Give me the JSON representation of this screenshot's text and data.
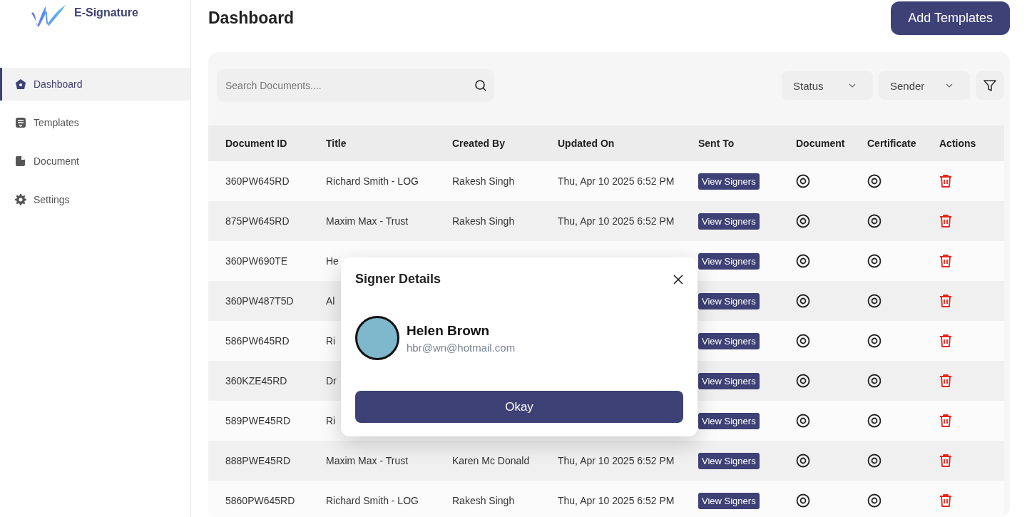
{
  "brand": {
    "name": "E-Signature"
  },
  "sidebar": {
    "items": [
      {
        "label": "Dashboard",
        "kind": "home",
        "selected": true
      },
      {
        "label": "Templates",
        "kind": "templates",
        "selected": false
      },
      {
        "label": "Document",
        "kind": "document",
        "selected": false
      },
      {
        "label": "Settings",
        "kind": "settings",
        "selected": false
      }
    ]
  },
  "header": {
    "title": "Dashboard",
    "add_button": "Add Templates"
  },
  "toolbar": {
    "search": {
      "placeholder": "Search Documents...."
    },
    "filters": [
      "Status",
      "Sender"
    ]
  },
  "table": {
    "columns": [
      "Document ID",
      "Title",
      "Created By",
      "Updated On",
      "Sent To",
      "Document",
      "Certificate",
      "Actions"
    ],
    "rows": [
      {
        "document_id": "360PW645RD",
        "title": "Richard Smith - LOG",
        "created_by": "Rakesh Singh",
        "updated_on": "Thu, Apr 10 2025 6:52 PM",
        "sent_to": "View Signers"
      },
      {
        "document_id": "875PW645RD",
        "title": "Maxim Max - Trust",
        "created_by": "Rakesh Singh",
        "updated_on": "Thu, Apr 10 2025 6:52 PM",
        "sent_to": "View Signers"
      },
      {
        "document_id": "360PW690TE",
        "title": "He",
        "sent_to": "View Signers"
      },
      {
        "document_id": "360PW487T5D",
        "title": "Al",
        "sent_to": "View Signers"
      },
      {
        "document_id": "586PW645RD",
        "title": "Ri",
        "sent_to": "View Signers"
      },
      {
        "document_id": "360KZE45RD",
        "title": "Dr",
        "sent_to": "View Signers"
      },
      {
        "document_id": "589PWE45RD",
        "title": "Ri",
        "sent_to": "View Signers"
      },
      {
        "document_id": "888PWE45RD",
        "title": "Maxim Max - Trust",
        "created_by": "Karen Mc Donald",
        "updated_on": "Thu, Apr 10 2025 6:52 PM",
        "sent_to": "View Signers"
      },
      {
        "document_id": "5860PW645RD",
        "title": "Richard Smith - LOG",
        "created_by": "Rakesh Singh",
        "updated_on": "Thu, Apr 10 2025 6:52 PM",
        "sent_to": "View Signers"
      }
    ]
  },
  "modal": {
    "title": "Signer Details",
    "signer": {
      "name": "Helen Brown",
      "email": "hbr@wn@hotmail.com"
    },
    "button": "Okay"
  }
}
